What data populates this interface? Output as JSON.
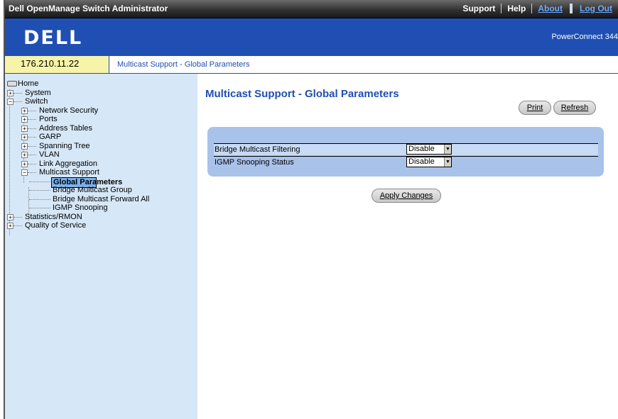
{
  "header": {
    "app_title": "Dell OpenManage Switch Administrator",
    "links": {
      "support": "Support",
      "help": "Help",
      "about": "About",
      "logout": "Log Out"
    }
  },
  "banner": {
    "logo": "DELL",
    "product": "PowerConnect 344"
  },
  "crumbbar": {
    "ip": "176.210.11.22",
    "breadcrumb": "Multicast Support - Global Parameters"
  },
  "tree": {
    "home": "Home",
    "system": "System",
    "switch": "Switch",
    "network_security": "Network Security",
    "ports": "Ports",
    "address_tables": "Address Tables",
    "garp": "GARP",
    "spanning_tree": "Spanning Tree",
    "vlan": "VLAN",
    "link_aggregation": "Link Aggregation",
    "multicast_support": "Multicast Support",
    "global_parameters": "Global Parameters",
    "bridge_multicast_group": "Bridge Multicast Group",
    "bridge_multicast_forward_all": "Bridge Multicast Forward All",
    "igmp_snooping": "IGMP Snooping",
    "statistics_rmon": "Statistics/RMON",
    "quality_of_service": "Quality of Service"
  },
  "content": {
    "title": "Multicast Support - Global Parameters",
    "print_label": "Print",
    "refresh_label": "Refresh",
    "fields": {
      "bridge_filtering_label": "Bridge Multicast Filtering",
      "bridge_filtering_value": "Disable",
      "igmp_status_label": "IGMP Snooping Status",
      "igmp_status_value": "Disable"
    },
    "apply_label": "Apply Changes"
  },
  "colors": {
    "brand_blue": "#1f4fb3",
    "sidebar_bg": "#d6e7f7",
    "ip_bg": "#f7f3a9",
    "panel_bg": "#a9c2ea"
  }
}
